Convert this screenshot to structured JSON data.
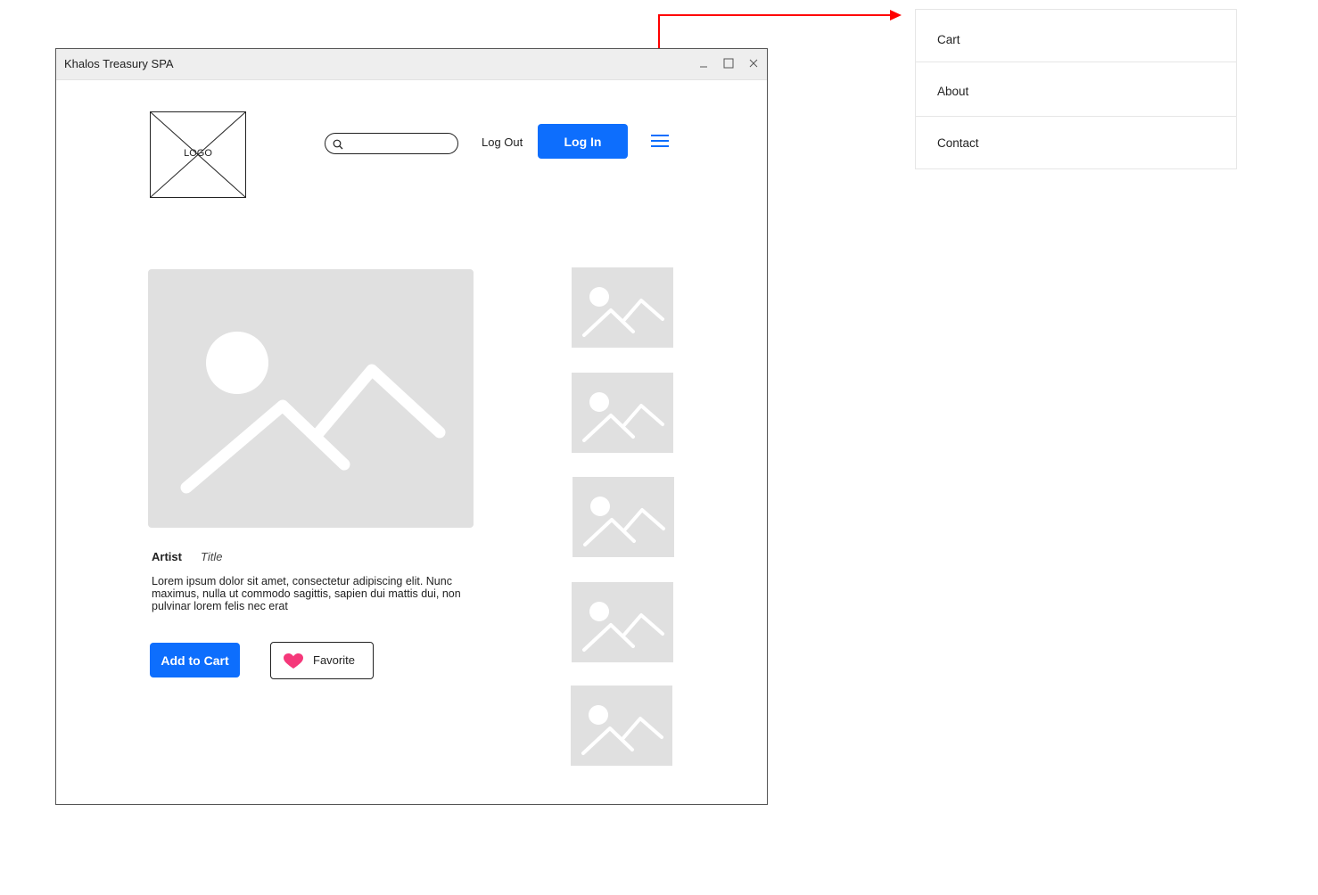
{
  "window": {
    "title": "Khalos Treasury SPA"
  },
  "header": {
    "logo_label": "LOGO",
    "search_placeholder": "",
    "logout_label": "Log Out",
    "login_label": "Log In"
  },
  "product": {
    "artist_label": "Artist",
    "title_label": "Title",
    "description": "Lorem ipsum dolor sit amet, consectetur adipiscing elit. Nunc maximus, nulla ut commodo sagittis, sapien dui mattis dui, non pulvinar lorem felis nec erat",
    "add_to_cart_label": "Add to Cart",
    "favorite_label": "Favorite"
  },
  "menu": {
    "items": [
      {
        "label": "Cart"
      },
      {
        "label": "About"
      },
      {
        "label": "Contact"
      }
    ]
  },
  "colors": {
    "primary": "#0d6efd",
    "placeholder": "#e0e0e0",
    "heart": "#f5387a",
    "annotation_arrow": "#ff0000"
  },
  "icons": {
    "search": "search-icon",
    "menu": "hamburger-menu-icon",
    "favorite": "heart-icon",
    "image": "image-placeholder-icon"
  }
}
